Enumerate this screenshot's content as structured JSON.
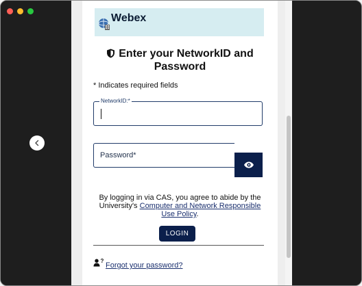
{
  "window": {
    "traffic_lights": [
      "close",
      "minimize",
      "zoom"
    ]
  },
  "nav": {
    "prev_icon": "chevron-left-icon"
  },
  "banner": {
    "brand": "Webex",
    "bg_color": "#d6edf1"
  },
  "form": {
    "heading": "Enter your NetworkID and Password",
    "required_note": "* Indicates required fields",
    "network_id": {
      "label": "NetworkID:*",
      "value": ""
    },
    "password": {
      "label": "Password*",
      "value": ""
    },
    "show_password_icon": "eye-icon",
    "agreement_prefix": "By logging in via CAS, you agree to abide by the University's",
    "agreement_link": "Computer and Network Responsible Use Policy",
    "agreement_suffix": ".",
    "login_label": "LOGIN",
    "forgot_link": "Forgot your password?"
  },
  "colors": {
    "primary_navy": "#0b1f4b",
    "link": "#1a2f6e"
  }
}
